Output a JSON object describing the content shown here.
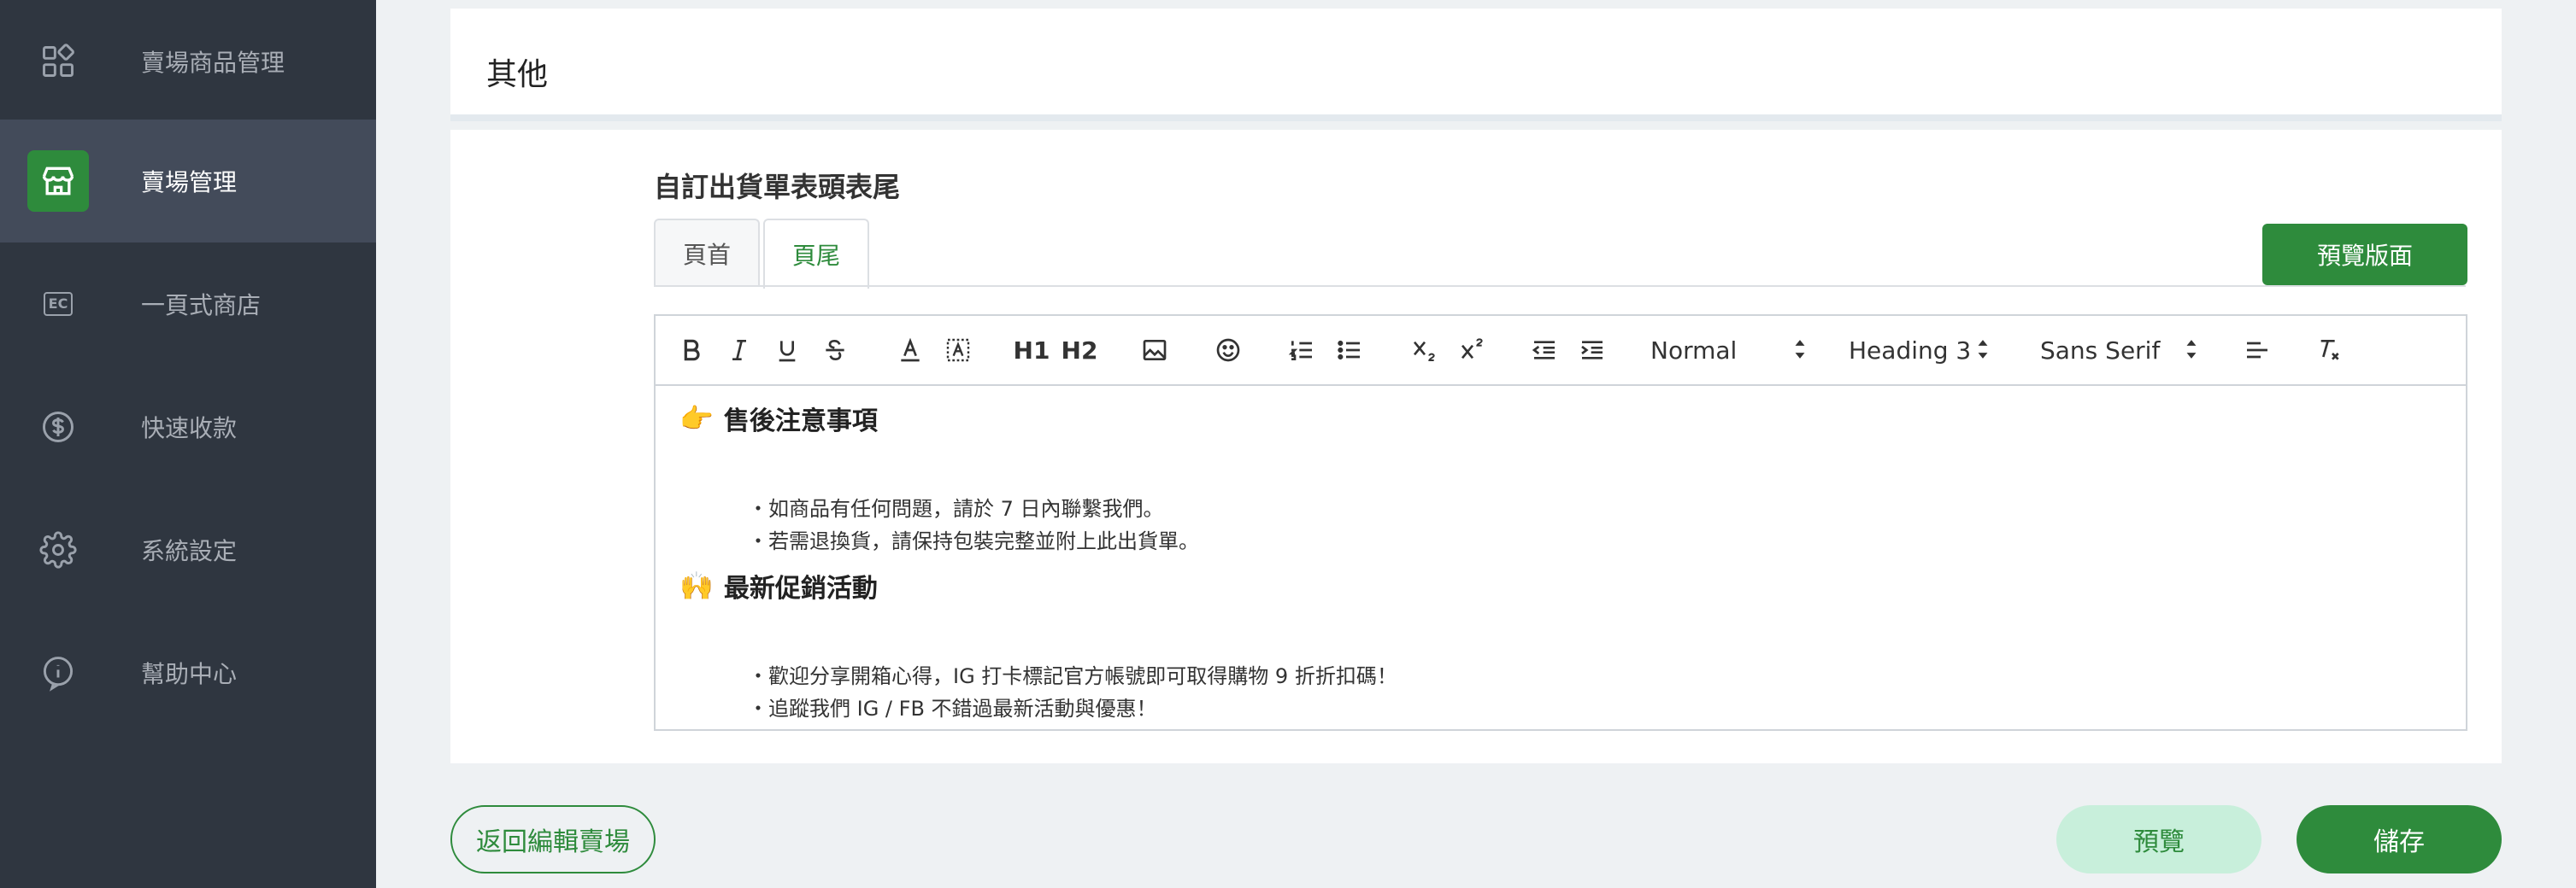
{
  "sidebar": {
    "items": [
      {
        "label": "賣場商品管理",
        "icon": "grid-icon"
      },
      {
        "label": "賣場管理",
        "icon": "store-icon",
        "active": true
      },
      {
        "label": "一頁式商店",
        "icon": "ec-shop-icon",
        "icon_text": "EC"
      },
      {
        "label": "快速收款",
        "icon": "dollar-icon"
      },
      {
        "label": "系統設定",
        "icon": "gear-icon"
      },
      {
        "label": "幫助中心",
        "icon": "info-icon"
      }
    ]
  },
  "top_card": {
    "title": "其他"
  },
  "main": {
    "section_title": "自訂出貨單表頭表尾",
    "tabs": [
      {
        "label": "頁首"
      },
      {
        "label": "頁尾",
        "active": true
      }
    ],
    "preview_layout_label": "預覽版面",
    "toolbar": {
      "h1": "H1",
      "h2": "H2",
      "size_select": "Normal",
      "heading_select": "Heading 3",
      "font_select": "Sans Serif"
    },
    "content": {
      "sections": [
        {
          "emoji": "👉",
          "heading": "售後注意事項",
          "items": [
            "・如商品有任何問題，請於 7 日內聯繫我們。",
            "・若需退換貨，請保持包裝完整並附上此出貨單。"
          ]
        },
        {
          "emoji": "🙌",
          "heading": "最新促銷活動",
          "items": [
            "・歡迎分享開箱心得，IG 打卡標記官方帳號即可取得購物 9 折折扣碼！",
            "・追蹤我們 IG / FB 不錯過最新活動與優惠！"
          ]
        }
      ]
    }
  },
  "footer": {
    "back_label": "返回編輯賣場",
    "preview_label": "預覽",
    "save_label": "儲存"
  },
  "colors": {
    "brand": "#2e8b3c",
    "sidebar": "#2f3640",
    "sidebar_active": "#434b5a",
    "preview_bg": "#c8efdb"
  }
}
